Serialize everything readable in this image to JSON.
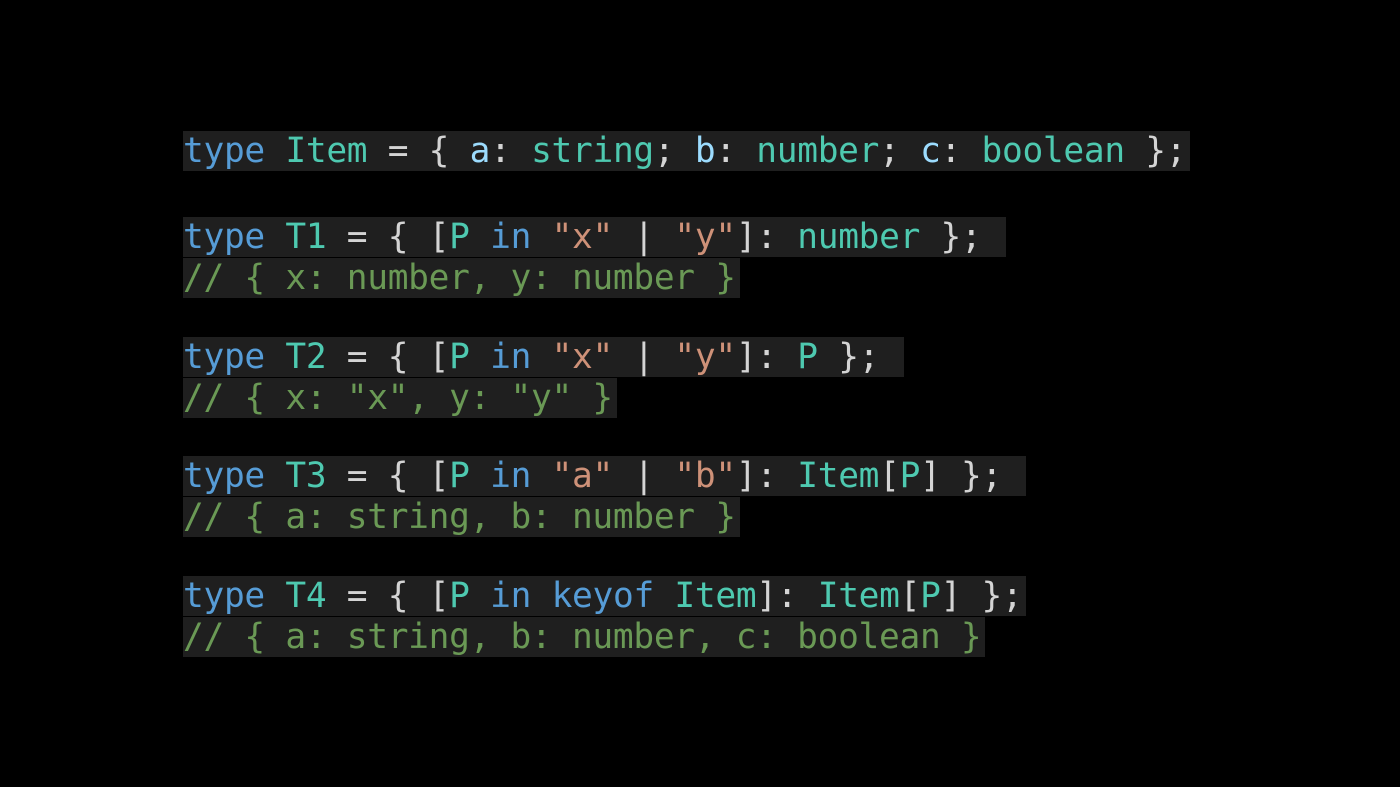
{
  "colors": {
    "background": "#000000",
    "line_highlight": "#1f1f1f",
    "keyword": "#569cd6",
    "typename": "#4ec9b0",
    "property": "#9cdcfe",
    "string": "#ce9178",
    "punctuation": "#d4d4d4",
    "comment": "#6a9955"
  },
  "lines": [
    {
      "tokens": [
        {
          "t": "type",
          "k": "keyword"
        },
        {
          "t": " ",
          "k": "punct"
        },
        {
          "t": "Item",
          "k": "typename"
        },
        {
          "t": " = { ",
          "k": "punct"
        },
        {
          "t": "a",
          "k": "property"
        },
        {
          "t": ": ",
          "k": "punct"
        },
        {
          "t": "string",
          "k": "typename"
        },
        {
          "t": "; ",
          "k": "punct"
        },
        {
          "t": "b",
          "k": "property"
        },
        {
          "t": ": ",
          "k": "punct"
        },
        {
          "t": "number",
          "k": "typename"
        },
        {
          "t": "; ",
          "k": "punct"
        },
        {
          "t": "c",
          "k": "property"
        },
        {
          "t": ": ",
          "k": "punct"
        },
        {
          "t": "boolean",
          "k": "typename"
        },
        {
          "t": " };",
          "k": "punct"
        }
      ]
    },
    {
      "tokens": [
        {
          "t": "type",
          "k": "keyword"
        },
        {
          "t": " ",
          "k": "punct"
        },
        {
          "t": "T1",
          "k": "typename"
        },
        {
          "t": " = { [",
          "k": "punct"
        },
        {
          "t": "P",
          "k": "typename"
        },
        {
          "t": " ",
          "k": "punct"
        },
        {
          "t": "in",
          "k": "keyword"
        },
        {
          "t": " ",
          "k": "punct"
        },
        {
          "t": "\"x\"",
          "k": "string"
        },
        {
          "t": " | ",
          "k": "punct"
        },
        {
          "t": "\"y\"",
          "k": "string"
        },
        {
          "t": "]: ",
          "k": "punct"
        },
        {
          "t": "number",
          "k": "typename"
        },
        {
          "t": " }; ",
          "k": "punct"
        }
      ]
    },
    {
      "tokens": [
        {
          "t": "// { x: number, y: number }",
          "k": "comment"
        }
      ]
    },
    {
      "tokens": [
        {
          "t": "type",
          "k": "keyword"
        },
        {
          "t": " ",
          "k": "punct"
        },
        {
          "t": "T2",
          "k": "typename"
        },
        {
          "t": " = { [",
          "k": "punct"
        },
        {
          "t": "P",
          "k": "typename"
        },
        {
          "t": " ",
          "k": "punct"
        },
        {
          "t": "in",
          "k": "keyword"
        },
        {
          "t": " ",
          "k": "punct"
        },
        {
          "t": "\"x\"",
          "k": "string"
        },
        {
          "t": " | ",
          "k": "punct"
        },
        {
          "t": "\"y\"",
          "k": "string"
        },
        {
          "t": "]: ",
          "k": "punct"
        },
        {
          "t": "P",
          "k": "typename"
        },
        {
          "t": " }; ",
          "k": "punct"
        }
      ]
    },
    {
      "tokens": [
        {
          "t": "// { x: \"x\", y: \"y\" }",
          "k": "comment"
        }
      ]
    },
    {
      "tokens": [
        {
          "t": "type",
          "k": "keyword"
        },
        {
          "t": " ",
          "k": "punct"
        },
        {
          "t": "T3",
          "k": "typename"
        },
        {
          "t": " = { [",
          "k": "punct"
        },
        {
          "t": "P",
          "k": "typename"
        },
        {
          "t": " ",
          "k": "punct"
        },
        {
          "t": "in",
          "k": "keyword"
        },
        {
          "t": " ",
          "k": "punct"
        },
        {
          "t": "\"a\"",
          "k": "string"
        },
        {
          "t": " | ",
          "k": "punct"
        },
        {
          "t": "\"b\"",
          "k": "string"
        },
        {
          "t": "]: ",
          "k": "punct"
        },
        {
          "t": "Item",
          "k": "typename"
        },
        {
          "t": "[",
          "k": "punct"
        },
        {
          "t": "P",
          "k": "typename"
        },
        {
          "t": "] }; ",
          "k": "punct"
        }
      ]
    },
    {
      "tokens": [
        {
          "t": "// { a: string, b: number }",
          "k": "comment"
        }
      ]
    },
    {
      "tokens": [
        {
          "t": "type",
          "k": "keyword"
        },
        {
          "t": " ",
          "k": "punct"
        },
        {
          "t": "T4",
          "k": "typename"
        },
        {
          "t": " = { [",
          "k": "punct"
        },
        {
          "t": "P",
          "k": "typename"
        },
        {
          "t": " ",
          "k": "punct"
        },
        {
          "t": "in",
          "k": "keyword"
        },
        {
          "t": " ",
          "k": "punct"
        },
        {
          "t": "keyof",
          "k": "keyword"
        },
        {
          "t": " ",
          "k": "punct"
        },
        {
          "t": "Item",
          "k": "typename"
        },
        {
          "t": "]: ",
          "k": "punct"
        },
        {
          "t": "Item",
          "k": "typename"
        },
        {
          "t": "[",
          "k": "punct"
        },
        {
          "t": "P",
          "k": "typename"
        },
        {
          "t": "] };",
          "k": "punct"
        }
      ]
    },
    {
      "tokens": [
        {
          "t": "// { a: string, b: number, c: boolean }",
          "k": "comment"
        }
      ]
    }
  ]
}
